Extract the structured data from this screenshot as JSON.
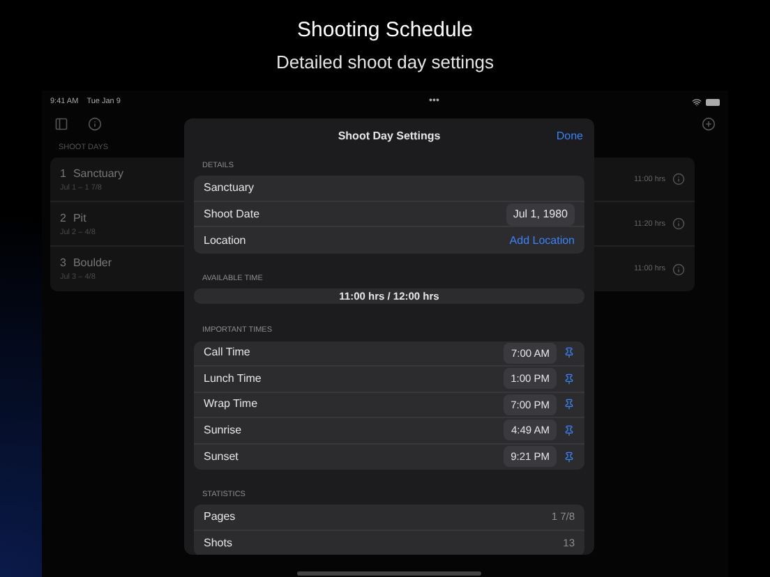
{
  "header": {
    "title": "Shooting Schedule",
    "subtitle": "Detailed shoot day settings"
  },
  "status_bar": {
    "time": "9:41 AM",
    "date": "Tue Jan 9",
    "dots": "•••"
  },
  "sidebar": {
    "section": "SHOOT DAYS",
    "items": [
      {
        "number": "1",
        "name": "Sanctuary",
        "detail": "Jul 1 – 1 7/8",
        "hours": "11:00 hrs"
      },
      {
        "number": "2",
        "name": "Pit",
        "detail": "Jul 2 – 4/8",
        "hours": "11:20 hrs"
      },
      {
        "number": "3",
        "name": "Boulder",
        "detail": "Jul 3 – 4/8",
        "hours": "11:00 hrs"
      }
    ]
  },
  "sheet": {
    "title": "Shoot Day Settings",
    "done": "Done",
    "details": {
      "label": "DETAILS",
      "rows": [
        {
          "kind": "text",
          "label": "Sanctuary"
        },
        {
          "kind": "pill",
          "label": "Shoot Date",
          "value": "Jul 1, 1980"
        },
        {
          "kind": "link",
          "label": "Location",
          "value": "Add Location"
        }
      ]
    },
    "available_time": {
      "label": "AVAILABLE TIME",
      "value": "11:00 hrs / 12:00 hrs"
    },
    "important_times": {
      "label": "IMPORTANT TIMES",
      "rows": [
        {
          "label": "Call Time",
          "value": "7:00 AM"
        },
        {
          "label": "Lunch Time",
          "value": "1:00 PM"
        },
        {
          "label": "Wrap Time",
          "value": "7:00 PM"
        },
        {
          "label": "Sunrise",
          "value": "4:49 AM"
        },
        {
          "label": "Sunset",
          "value": "9:21 PM"
        }
      ]
    },
    "statistics": {
      "label": "STATISTICS",
      "rows": [
        {
          "label": "Pages",
          "value": "1 7/8"
        },
        {
          "label": "Shots",
          "value": "13"
        }
      ]
    }
  }
}
